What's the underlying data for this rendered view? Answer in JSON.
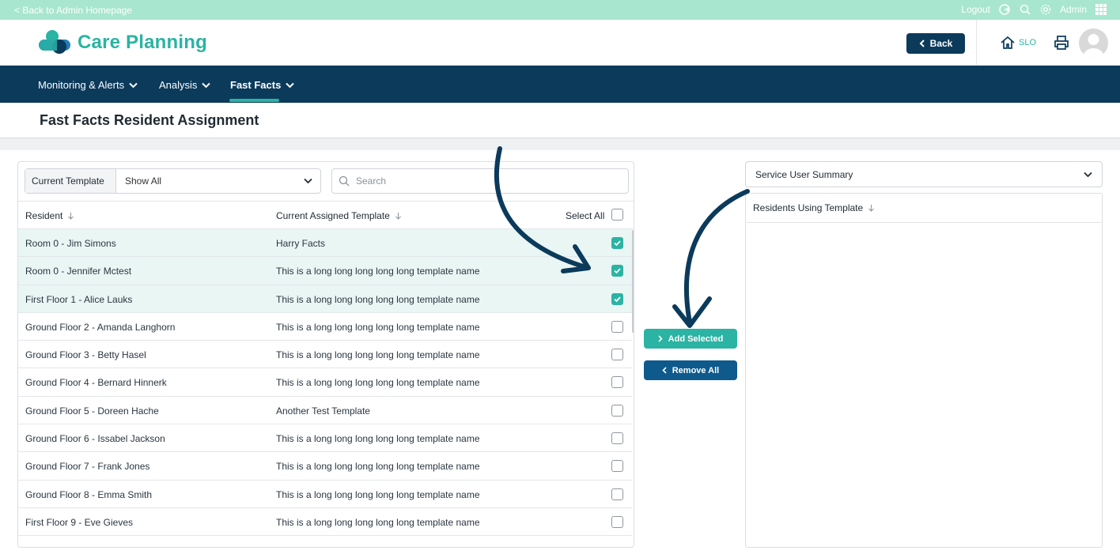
{
  "topbar": {
    "back_link": "< Back to Admin Homepage",
    "logout": "Logout",
    "admin": "Admin"
  },
  "header": {
    "app_title": "Care Planning",
    "back_button": "Back",
    "home_label": "SLO"
  },
  "nav": {
    "items": [
      {
        "label": "Monitoring & Alerts"
      },
      {
        "label": "Analysis"
      },
      {
        "label": "Fast Facts"
      }
    ],
    "active": "Fast Facts"
  },
  "page": {
    "title": "Fast Facts Resident Assignment"
  },
  "filters": {
    "template_label": "Current Template",
    "template_value": "Show All",
    "search_placeholder": "Search"
  },
  "table": {
    "columns": {
      "resident": "Resident",
      "template": "Current Assigned Template",
      "select_all": "Select All"
    },
    "rows": [
      {
        "resident": "Room 0 - Jim Simons",
        "template": "Harry Facts",
        "checked": true
      },
      {
        "resident": "Room 0 - Jennifer Mctest",
        "template": "This is a long long long long long template name",
        "checked": true
      },
      {
        "resident": "First Floor 1 - Alice Lauks",
        "template": "This is a long long long long long template name",
        "checked": true
      },
      {
        "resident": "Ground Floor 2 - Amanda Langhorn",
        "template": "This is a long long long long long template name",
        "checked": false
      },
      {
        "resident": "Ground Floor 3 - Betty Hasel",
        "template": "This is a long long long long long template name",
        "checked": false
      },
      {
        "resident": "Ground Floor 4 - Bernard Hinnerk",
        "template": "This is a long long long long long template name",
        "checked": false
      },
      {
        "resident": "Ground Floor 5 - Doreen Hache",
        "template": "Another Test Template",
        "checked": false
      },
      {
        "resident": "Ground Floor 6 - Issabel Jackson",
        "template": "This is a long long long long long template name",
        "checked": false
      },
      {
        "resident": "Ground Floor 7 - Frank Jones",
        "template": "This is a long long long long long template name",
        "checked": false
      },
      {
        "resident": "Ground Floor 8 - Emma Smith",
        "template": "This is a long long long long long template name",
        "checked": false
      },
      {
        "resident": "First Floor 9 - Eve Gieves",
        "template": "This is a long long long long long template name",
        "checked": false
      }
    ]
  },
  "actions": {
    "add_selected": "Add Selected",
    "remove_all": "Remove All"
  },
  "summary": {
    "select_value": "Service User Summary",
    "residents_header": "Residents Using Template"
  },
  "colors": {
    "teal": "#2bb3a3",
    "navy": "#0b3a5b",
    "mint": "#a8e6cf",
    "remove_blue": "#0e5a8c"
  }
}
